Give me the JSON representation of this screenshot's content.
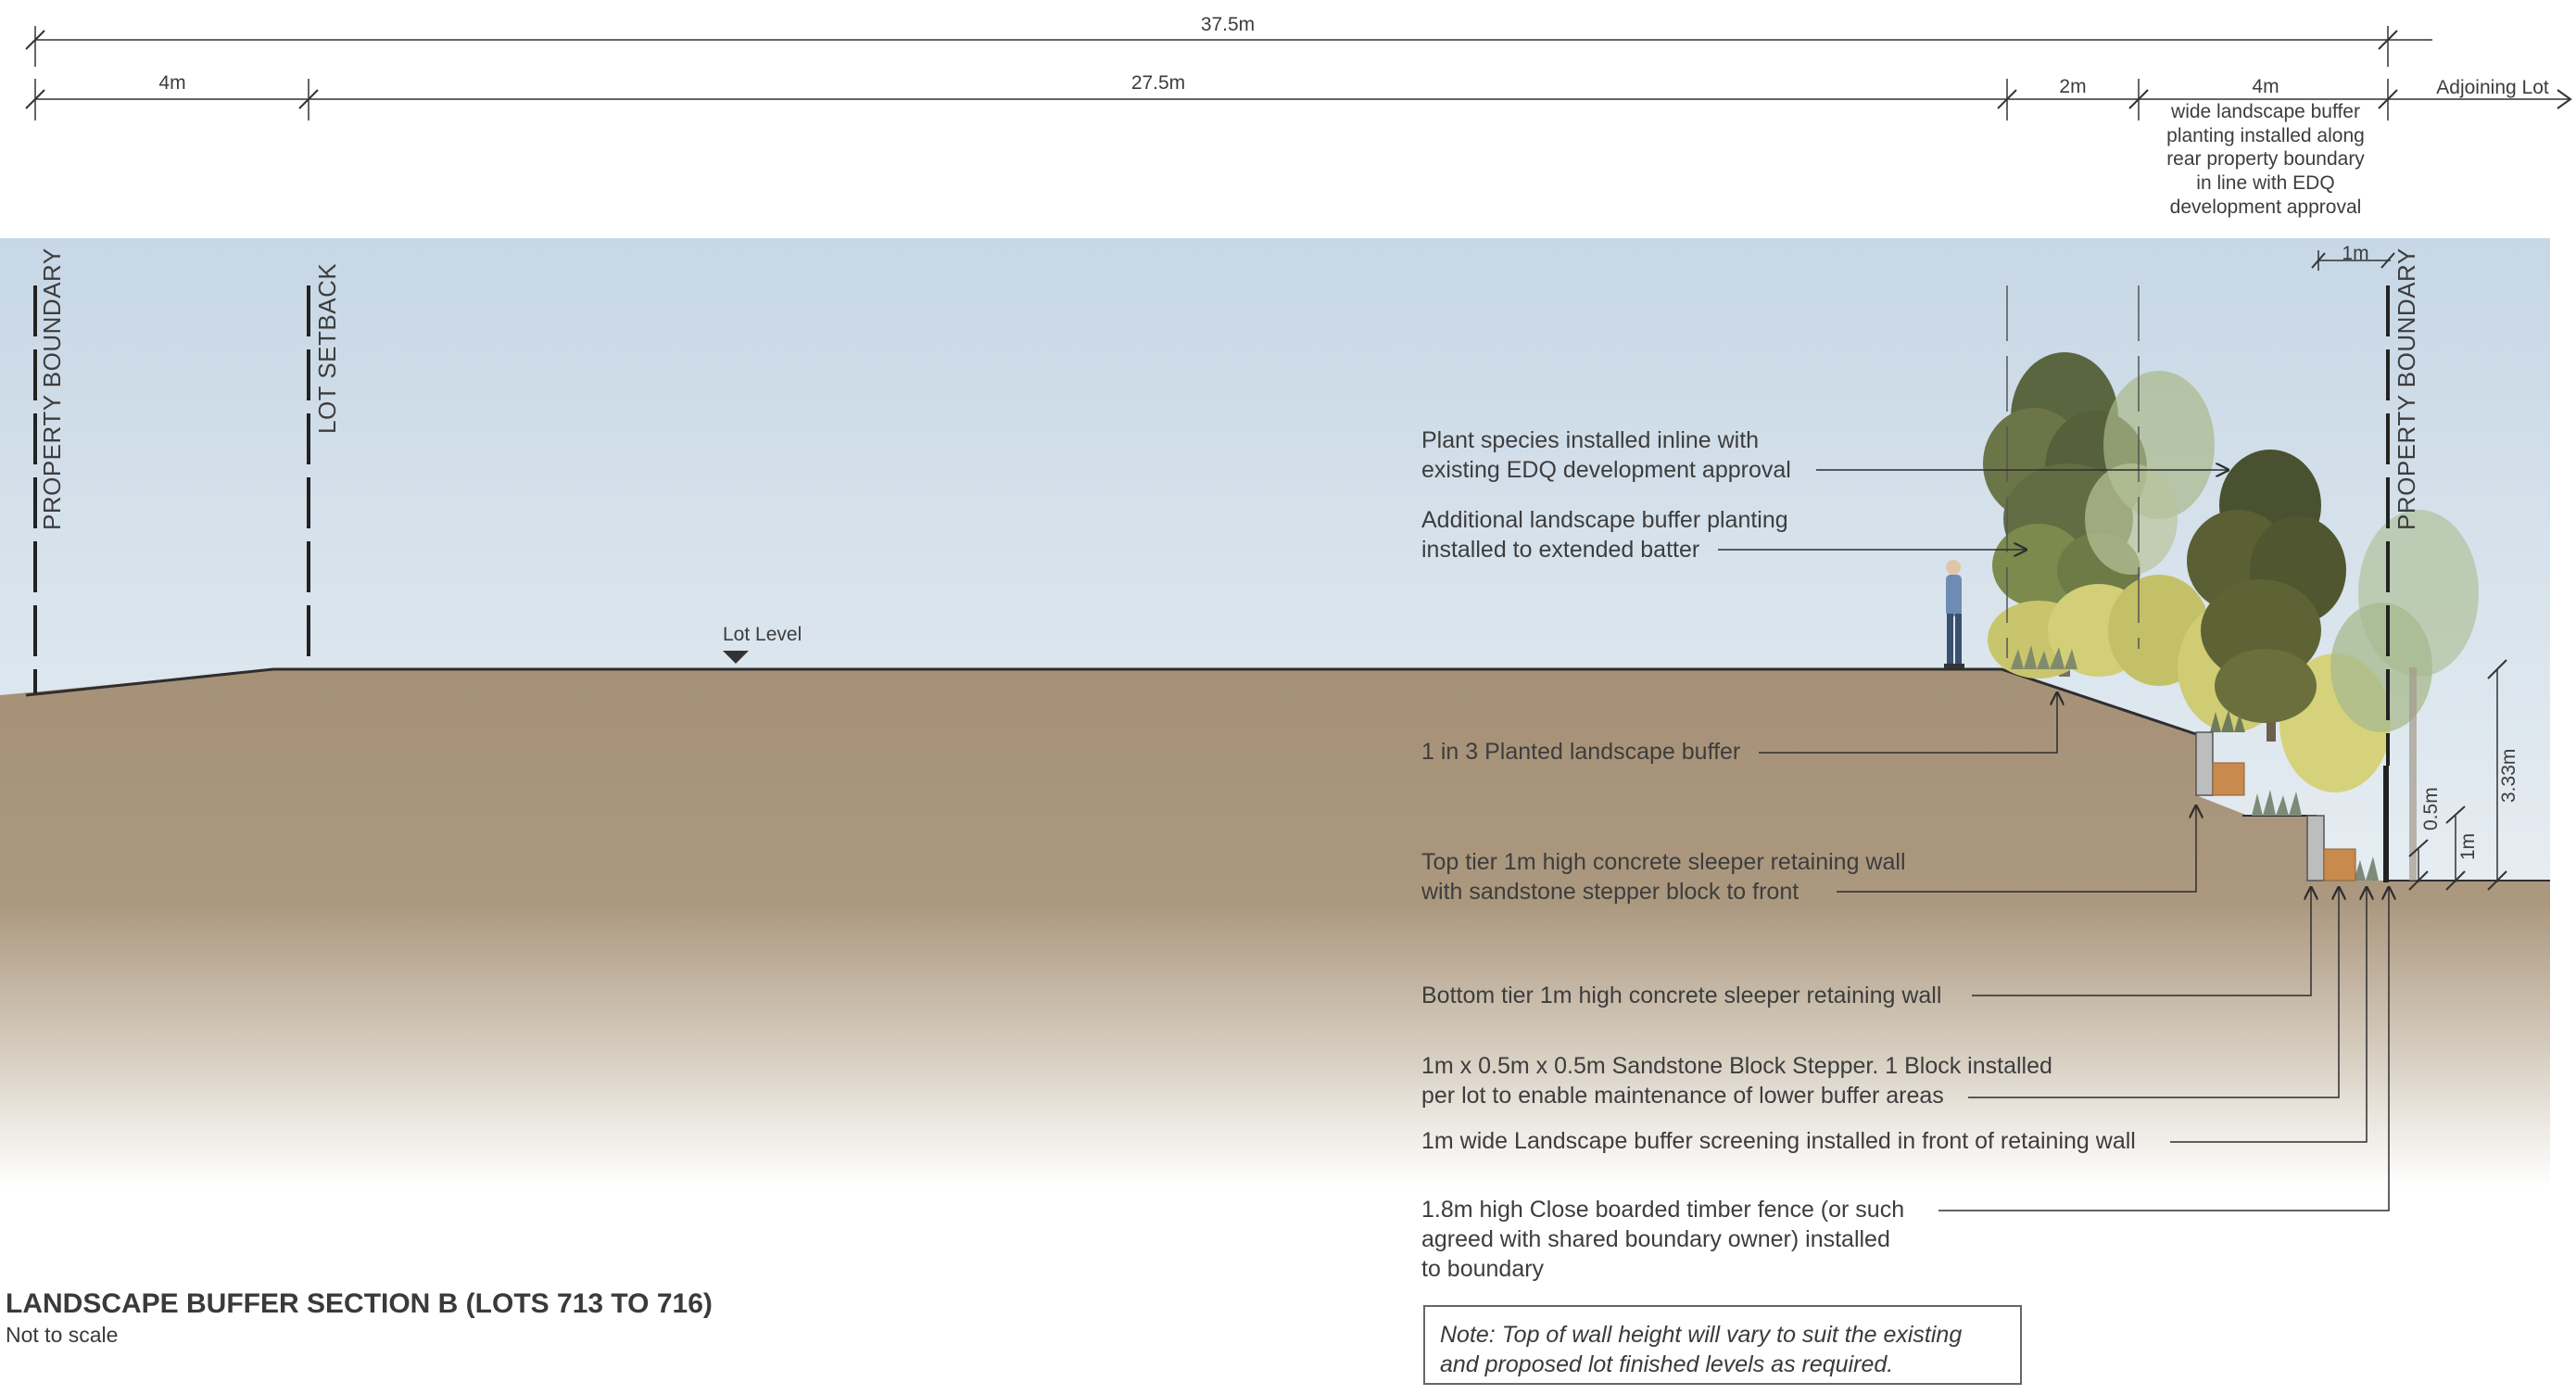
{
  "diagram": {
    "title": "LANDSCAPE BUFFER SECTION B (LOTS 713 TO 716)",
    "subtitle": "Not to scale",
    "note": {
      "line1": "Note: Top of wall height will vary to suit the existing",
      "line2": "and proposed lot finished levels as required."
    },
    "dimensions": {
      "overall": "37.5m",
      "setback": "4m",
      "lot_depth": "27.5m",
      "batter": "2m",
      "buffer": "4m",
      "adjoining": "Adjoining Lot",
      "buffer_desc": [
        "wide landscape buffer",
        "planting installed along",
        "rear property boundary",
        "in line with EDQ",
        "development approval"
      ],
      "fence_offset": "1m",
      "height_total": "3.33m",
      "height_tier": "1m",
      "height_step": "0.5m"
    },
    "boundaries": {
      "left_boundary": "PROPERTY BOUNDARY",
      "lot_setback": "LOT SETBACK",
      "right_boundary": "PROPERTY BOUNDARY"
    },
    "lot_level": "Lot Level",
    "annotations": {
      "plant_species": [
        "Plant species installed inline with",
        "existing EDQ  development approval"
      ],
      "additional_planting": [
        "Additional landscape buffer planting",
        "installed to extended batter"
      ],
      "planted_buffer": "1 in 3 Planted landscape buffer",
      "top_tier": [
        "Top tier 1m high concrete sleeper retaining wall",
        "with sandstone stepper block to front"
      ],
      "bottom_tier": "Bottom tier 1m high concrete sleeper retaining wall",
      "stepper": [
        "1m x 0.5m x 0.5m Sandstone Block Stepper. 1 Block installed",
        "per lot to enable maintenance of lower buffer areas"
      ],
      "screening": "1m wide Landscape buffer screening installed in front of retaining wall",
      "fence": [
        "1.8m high Close boarded timber fence (or such",
        "agreed with shared boundary owner) installed",
        "to boundary"
      ]
    },
    "colors": {
      "sky_top": "#c9d8e6",
      "sky_bottom": "#e8eef3",
      "ground": "#a89479",
      "line": "#2e2e2e",
      "wall": "#bfbfbf",
      "sandstone": "#c98a4e",
      "tree_dark": "#4f5b36",
      "tree_mid": "#7d8a4d",
      "tree_yellow": "#c8c46a"
    }
  }
}
